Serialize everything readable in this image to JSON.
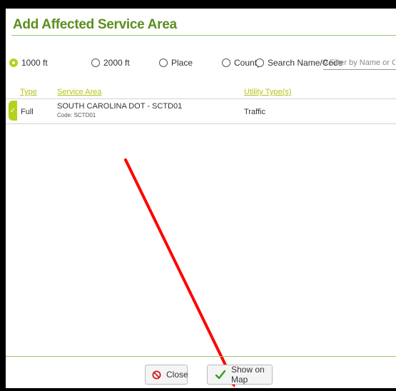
{
  "dialog": {
    "title": "Add Affected Service Area",
    "radios": [
      {
        "label": "1000 ft",
        "selected": true
      },
      {
        "label": "2000 ft",
        "selected": false
      },
      {
        "label": "Place",
        "selected": false
      },
      {
        "label": "County",
        "selected": false
      },
      {
        "label": "Search Name/Code",
        "selected": false
      }
    ],
    "filter_placeholder": "Filter by Name or Code",
    "columns": {
      "type": "Type",
      "service_area": "Service Area",
      "utility_types": "Utility Type(s)"
    },
    "rows": [
      {
        "type": "Full",
        "service_area": "SOUTH CAROLINA DOT - SCTD01",
        "code": "Code: SCTD01",
        "utility_types": "Traffic",
        "checked": true
      }
    ],
    "buttons": {
      "close": "Close",
      "show_on_map": "Show on Map"
    }
  },
  "colors": {
    "title": "#5a8f1e",
    "accent": "#b5d11c",
    "header_link": "#b5c21a",
    "annotation_arrow": "#ff0000",
    "close_icon": "#d0202a",
    "check_icon": "#2f9e1f"
  }
}
